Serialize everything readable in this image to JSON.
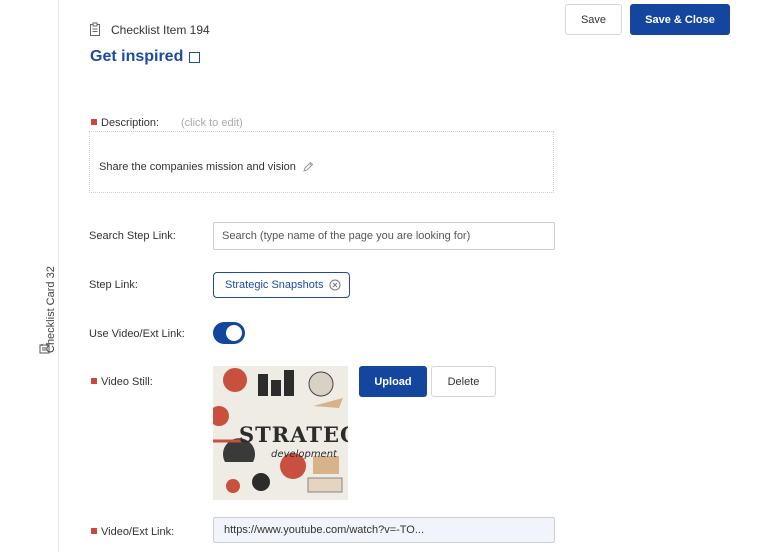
{
  "sidebar": {
    "card_label": "Checklist Card 32",
    "card_icon": "card-icon"
  },
  "header": {
    "item_label": "Checklist Item 194",
    "item_icon": "clipboard-icon",
    "title": "Get inspired"
  },
  "toolbar": {
    "save_label": "Save",
    "save_close_label": "Save & Close"
  },
  "description": {
    "label": "Description:",
    "hint": "(click to edit)",
    "text": "Share the companies mission and vision",
    "edit_icon": "pencil-icon"
  },
  "search_step_link": {
    "label": "Search Step Link:",
    "placeholder": "Search (type name of the page you are looking for)",
    "value": ""
  },
  "step_link": {
    "label": "Step Link:",
    "chip": "Strategic Snapshots",
    "remove_icon": "close-circle-icon"
  },
  "use_video": {
    "label": "Use Video/Ext Link:",
    "enabled": true
  },
  "video_still": {
    "label": "Video Still:",
    "image_text": "STRATEGY",
    "image_subtext": "development",
    "upload_label": "Upload",
    "delete_label": "Delete"
  },
  "video_link": {
    "label": "Video/Ext Link:",
    "value": "https://www.youtube.com/watch?v=-TO..."
  },
  "colors": {
    "accent": "#1446a0",
    "title": "#1f4aa3",
    "required": "#c8493f"
  }
}
